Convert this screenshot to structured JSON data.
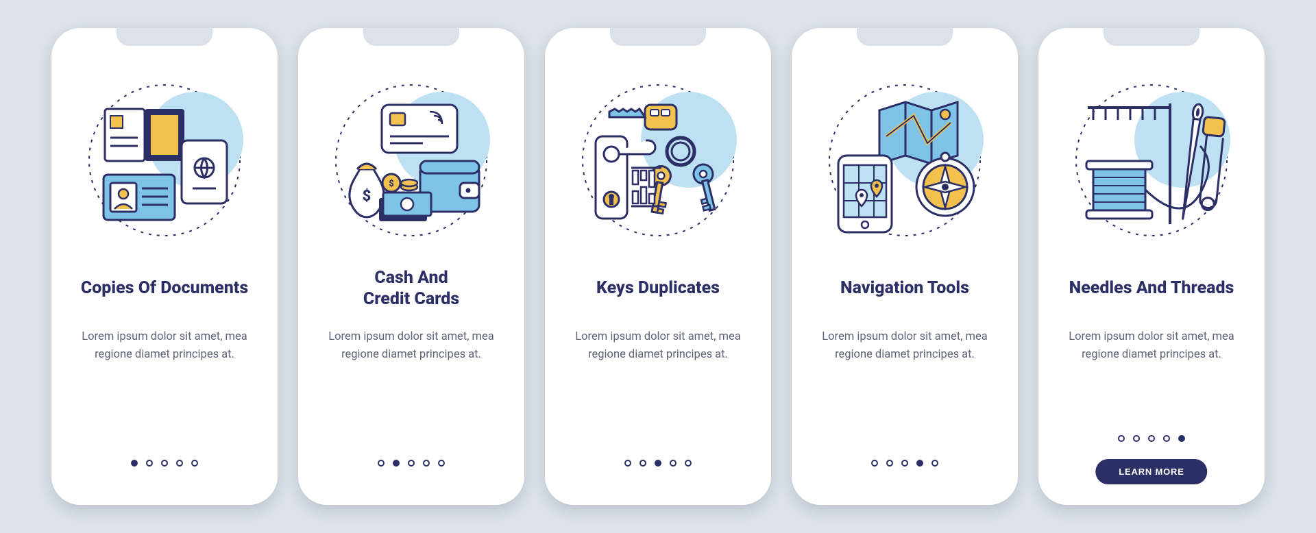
{
  "palette": {
    "bg": "#dbe2e9",
    "card": "#ffffff",
    "ink": "#2b2f66",
    "muted": "#5f6478",
    "accentBlue": "#7fc4e8",
    "accentBlueFill": "#bde1f2",
    "accentYellow": "#f2c14e",
    "stroke": "#2b2f66"
  },
  "pagination": {
    "count": 5
  },
  "cta": {
    "label": "LEARN MORE"
  },
  "screens": [
    {
      "id": "documents",
      "icon": "documents-icon",
      "title": "Copies Of Documents",
      "body": "Lorem ipsum dolor sit amet, mea regione diamet principes at.",
      "activeIndex": 0,
      "hasCta": false
    },
    {
      "id": "cash",
      "icon": "cash-credit-icon",
      "title": "Cash And\nCredit Cards",
      "body": "Lorem ipsum dolor sit amet, mea regione diamet principes at.",
      "activeIndex": 1,
      "hasCta": false
    },
    {
      "id": "keys",
      "icon": "keys-icon",
      "title": "Keys Duplicates",
      "body": "Lorem ipsum dolor sit amet, mea regione diamet principes at.",
      "activeIndex": 2,
      "hasCta": false
    },
    {
      "id": "nav",
      "icon": "navigation-icon",
      "title": "Navigation Tools",
      "body": "Lorem ipsum dolor sit amet, mea regione diamet principes at.",
      "activeIndex": 3,
      "hasCta": false
    },
    {
      "id": "sewing",
      "icon": "needles-threads-icon",
      "title": "Needles And Threads",
      "body": "Lorem ipsum dolor sit amet, mea regione diamet principes at.",
      "activeIndex": 4,
      "hasCta": true
    }
  ]
}
